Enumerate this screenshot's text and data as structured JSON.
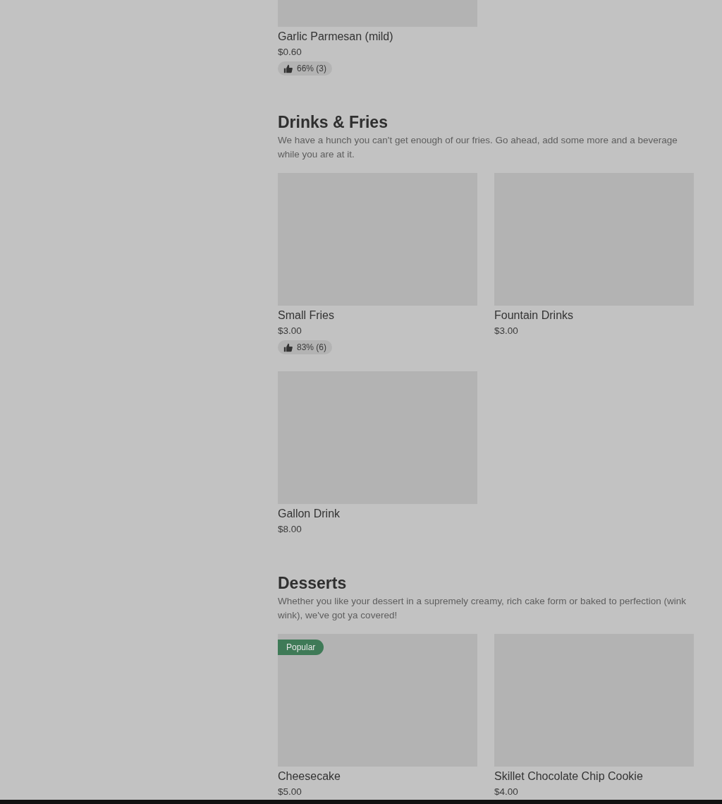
{
  "sections": [
    {
      "items": [
        {
          "name": "Garlic Parmesan (mild)",
          "price": "$0.60",
          "rating": "66% (3)"
        }
      ]
    },
    {
      "title": "Drinks & Fries",
      "description": "We have a hunch you can't get enough of our fries. Go ahead, add some more and a beverage while you are at it.",
      "items": [
        {
          "name": "Small Fries",
          "price": "$3.00",
          "rating": "83% (6)"
        },
        {
          "name": "Fountain Drinks",
          "price": "$3.00"
        },
        {
          "name": "Gallon Drink",
          "price": "$8.00"
        }
      ]
    },
    {
      "title": "Desserts",
      "description": "Whether you like your dessert in a supremely creamy, rich cake form or baked to perfection (wink wink), we've got ya covered!",
      "items": [
        {
          "name": "Cheesecake",
          "price": "$5.00",
          "badge": "Popular"
        },
        {
          "name": "Skillet Chocolate Chip Cookie",
          "price": "$4.00"
        }
      ]
    }
  ]
}
